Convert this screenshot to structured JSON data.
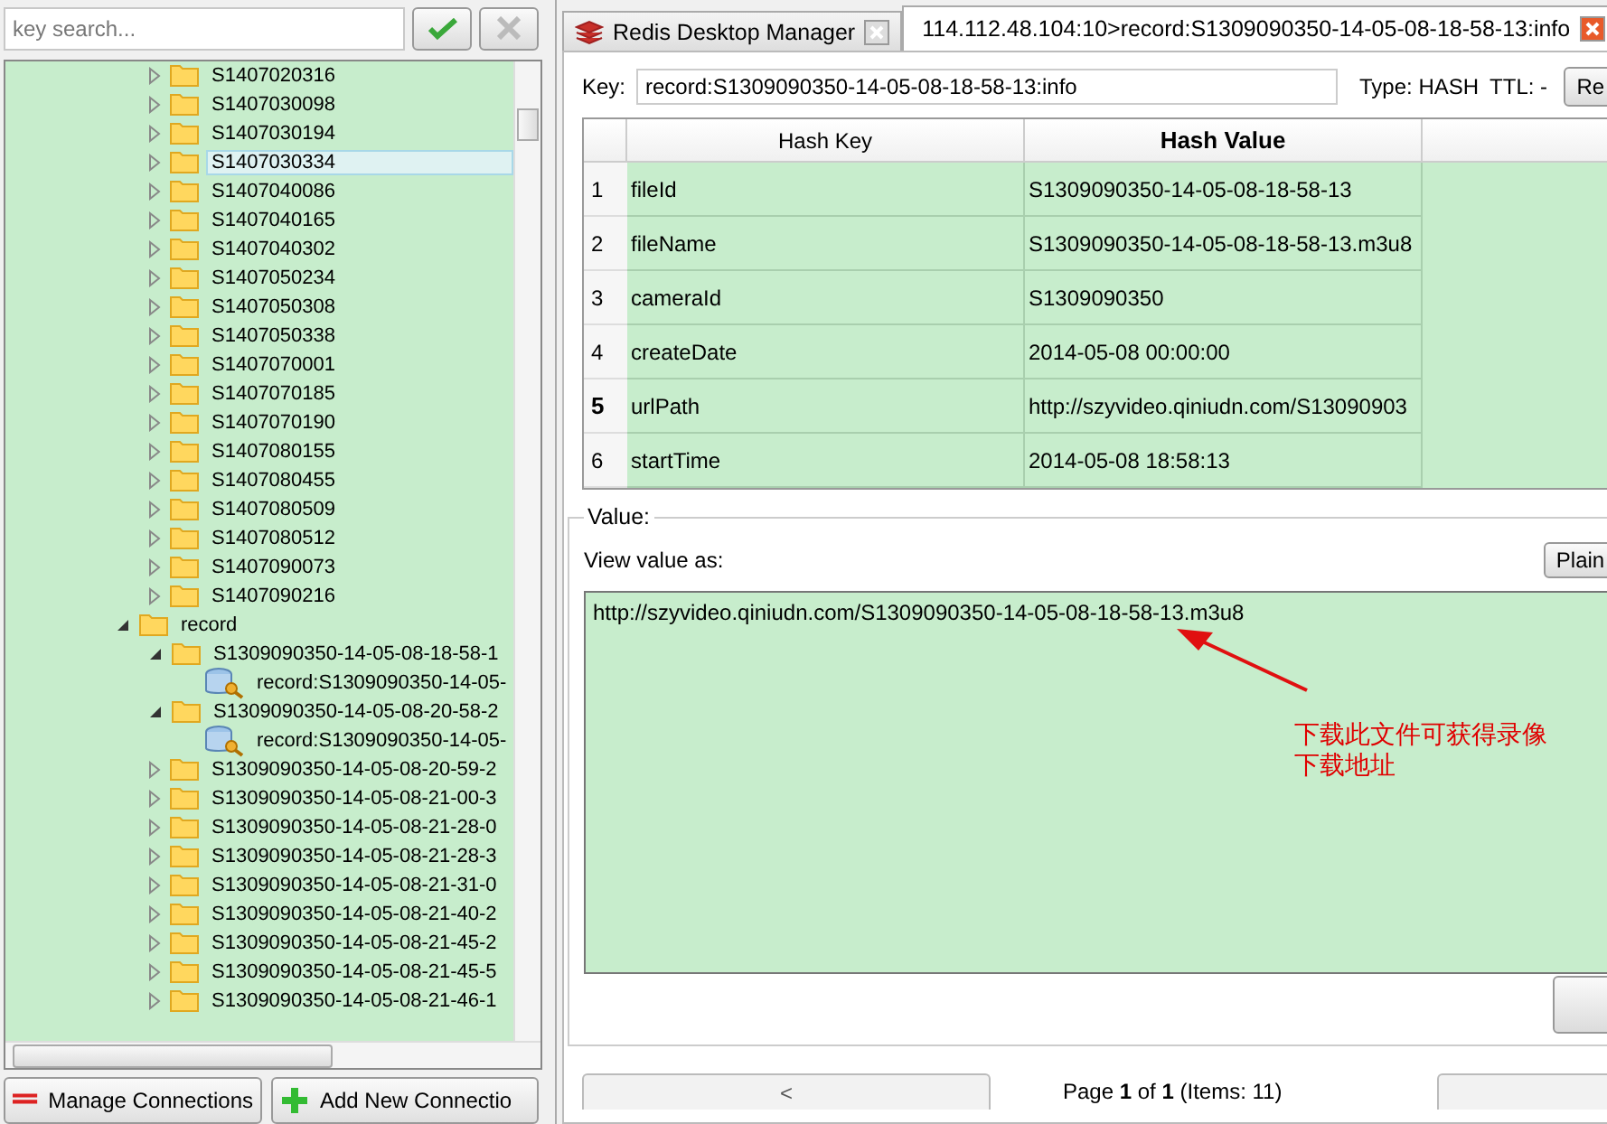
{
  "search": {
    "placeholder": "key search..."
  },
  "tree": {
    "continued_items": [
      {
        "kind": "folder",
        "label": "S1407020316",
        "expanded": false,
        "selected": false
      },
      {
        "kind": "folder",
        "label": "S1407030098",
        "expanded": false,
        "selected": false
      },
      {
        "kind": "folder",
        "label": "S1407030194",
        "expanded": false,
        "selected": false
      },
      {
        "kind": "folder",
        "label": "S1407030334",
        "expanded": false,
        "selected": true
      },
      {
        "kind": "folder",
        "label": "S1407040086",
        "expanded": false,
        "selected": false
      },
      {
        "kind": "folder",
        "label": "S1407040165",
        "expanded": false,
        "selected": false
      },
      {
        "kind": "folder",
        "label": "S1407040302",
        "expanded": false,
        "selected": false
      },
      {
        "kind": "folder",
        "label": "S1407050234",
        "expanded": false,
        "selected": false
      },
      {
        "kind": "folder",
        "label": "S1407050308",
        "expanded": false,
        "selected": false
      },
      {
        "kind": "folder",
        "label": "S1407050338",
        "expanded": false,
        "selected": false
      },
      {
        "kind": "folder",
        "label": "S1407070001",
        "expanded": false,
        "selected": false
      },
      {
        "kind": "folder",
        "label": "S1407070185",
        "expanded": false,
        "selected": false
      },
      {
        "kind": "folder",
        "label": "S1407070190",
        "expanded": false,
        "selected": false
      },
      {
        "kind": "folder",
        "label": "S1407080155",
        "expanded": false,
        "selected": false
      },
      {
        "kind": "folder",
        "label": "S1407080455",
        "expanded": false,
        "selected": false
      },
      {
        "kind": "folder",
        "label": "S1407080509",
        "expanded": false,
        "selected": false
      },
      {
        "kind": "folder",
        "label": "S1407080512",
        "expanded": false,
        "selected": false
      },
      {
        "kind": "folder",
        "label": "S1407090073",
        "expanded": false,
        "selected": false
      },
      {
        "kind": "folder",
        "label": "S1407090216",
        "expanded": false,
        "selected": false
      }
    ],
    "items": [
      {
        "kind": "folder",
        "label": "record",
        "expanded": true,
        "selected": false,
        "children": [
          {
            "kind": "folder",
            "label": "S1309090350-14-05-08-18-58-1",
            "expanded": true,
            "selected": false,
            "children": [
              {
                "kind": "key",
                "label": "record:S1309090350-14-05-",
                "selected": false
              }
            ]
          },
          {
            "kind": "folder",
            "label": "S1309090350-14-05-08-20-58-2",
            "expanded": true,
            "selected": false,
            "children": [
              {
                "kind": "key",
                "label": "record:S1309090350-14-05-",
                "selected": false
              }
            ]
          },
          {
            "kind": "folder",
            "label": "S1309090350-14-05-08-20-59-2",
            "expanded": false,
            "selected": false
          },
          {
            "kind": "folder",
            "label": "S1309090350-14-05-08-21-00-3",
            "expanded": false,
            "selected": false
          },
          {
            "kind": "folder",
            "label": "S1309090350-14-05-08-21-28-0",
            "expanded": false,
            "selected": false
          },
          {
            "kind": "folder",
            "label": "S1309090350-14-05-08-21-28-3",
            "expanded": false,
            "selected": false
          },
          {
            "kind": "folder",
            "label": "S1309090350-14-05-08-21-31-0",
            "expanded": false,
            "selected": false
          },
          {
            "kind": "folder",
            "label": "S1309090350-14-05-08-21-40-2",
            "expanded": false,
            "selected": false
          },
          {
            "kind": "folder",
            "label": "S1309090350-14-05-08-21-45-2",
            "expanded": false,
            "selected": false
          },
          {
            "kind": "folder",
            "label": "S1309090350-14-05-08-21-45-5",
            "expanded": false,
            "selected": false
          },
          {
            "kind": "folder",
            "label": "S1309090350-14-05-08-21-46-1",
            "expanded": false,
            "selected": false
          }
        ]
      }
    ]
  },
  "connection_buttons": [
    "Manage Connections",
    "Add New Connectio"
  ],
  "tabs": [
    {
      "label": "Redis Desktop Manager",
      "selected": false
    },
    {
      "label": "114.112.48.104:10>record:S1309090350-14-05-08-18-58-13:info",
      "selected": true
    }
  ],
  "key_view": {
    "key_label": "Key:",
    "key_value": "record:S1309090350-14-05-08-18-58-13:info",
    "type": "Type: HASH",
    "ttl": "TTL: -",
    "action_button": "Re"
  },
  "table": {
    "columns": [
      {
        "label": "Hash Key",
        "selected": false
      },
      {
        "label": "Hash Value",
        "selected": true
      }
    ],
    "rows": [
      {
        "index": "1",
        "key": "fileId",
        "value": "S1309090350-14-05-08-18-58-13",
        "selected": false
      },
      {
        "index": "2",
        "key": "fileName",
        "value": "S1309090350-14-05-08-18-58-13.m3u8",
        "selected": false
      },
      {
        "index": "3",
        "key": "cameraId",
        "value": "S1309090350",
        "selected": false
      },
      {
        "index": "4",
        "key": "createDate",
        "value": "2014-05-08 00:00:00",
        "selected": false
      },
      {
        "index": "5",
        "key": "urlPath",
        "value": "http://szyvideo.qiniudn.com/S13090903",
        "selected": true
      },
      {
        "index": "6",
        "key": "startTime",
        "value": "2014-05-08 18:58:13",
        "selected": false
      }
    ]
  },
  "value_panel": {
    "title": "Value:",
    "view_as_label": "View value as:",
    "format_button": "Plain",
    "value": "http://szyvideo.qiniudn.com/S1309090350-14-05-08-18-58-13.m3u8",
    "annotation": [
      "下载此文件可获得录像",
      "下载地址"
    ]
  },
  "pagination": {
    "prev": "<",
    "text": "Page **1** of **1** (Items: 11)"
  }
}
